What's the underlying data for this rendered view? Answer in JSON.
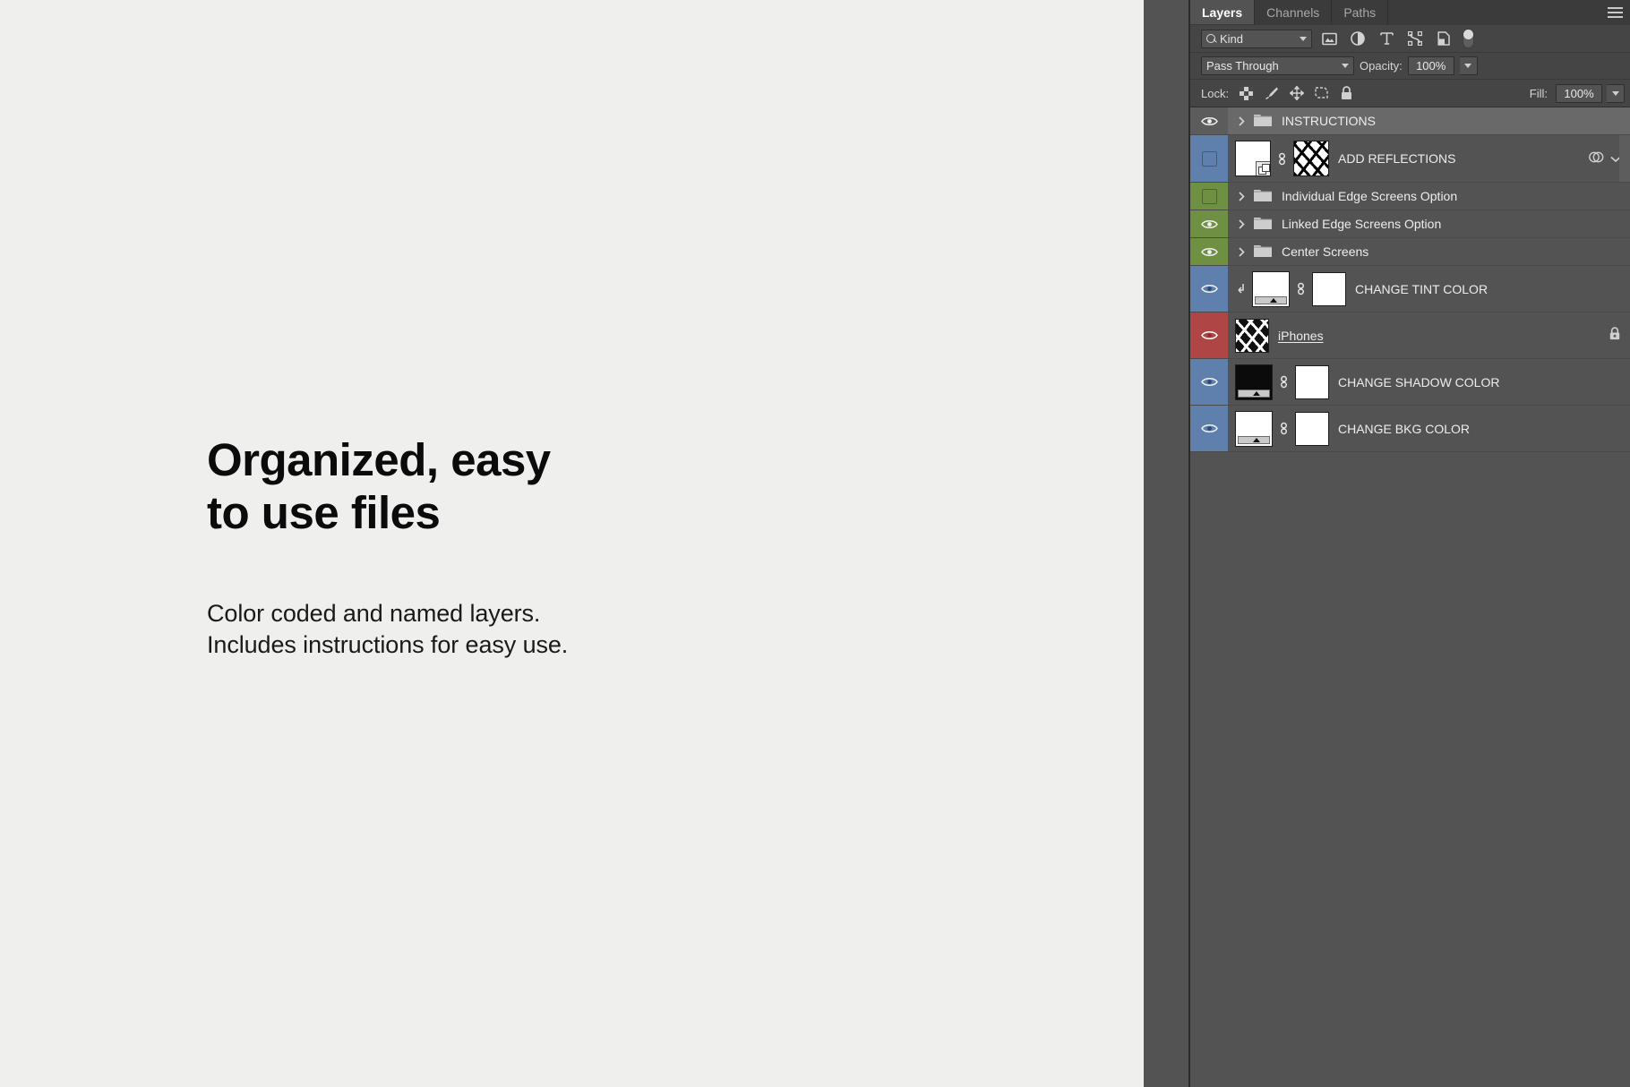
{
  "marketing": {
    "headline": "Organized, easy\nto use files",
    "subcopy": "Color coded and named layers.\nIncludes instructions for easy use."
  },
  "panel": {
    "tabs": [
      {
        "label": "Layers",
        "active": true
      },
      {
        "label": "Channels",
        "active": false
      },
      {
        "label": "Paths",
        "active": false
      }
    ],
    "menu_icon": "hamburger-menu-icon",
    "filter_row": {
      "kind_label": "Kind",
      "kind_icon": "search-icon",
      "filter_icons": [
        "pixel-layer-filter-icon",
        "adjustment-layer-filter-icon",
        "type-layer-filter-icon",
        "shape-layer-filter-icon",
        "smart-object-filter-icon"
      ],
      "toggle_name": "filter-enable-toggle"
    },
    "blend_row": {
      "blend_mode": "Pass Through",
      "opacity_label": "Opacity:",
      "opacity_value": "100%"
    },
    "lock_row": {
      "lock_label": "Lock:",
      "lock_icons": [
        "lock-transparent-pixels-icon",
        "lock-image-pixels-icon",
        "lock-position-icon",
        "lock-artboard-nesting-icon",
        "lock-all-icon"
      ],
      "fill_label": "Fill:",
      "fill_value": "100%"
    },
    "layers": [
      {
        "name": "INSTRUCTIONS",
        "type": "group",
        "color": "none",
        "visible": true,
        "selected": true,
        "locked": false,
        "renaming": false
      },
      {
        "name": "ADD REFLECTIONS",
        "type": "smart-object",
        "color": "blue",
        "visible": false,
        "selected": false,
        "locked": false,
        "renaming": false,
        "has_effects": true
      },
      {
        "name": "Individual Edge Screens Option",
        "type": "group",
        "color": "green",
        "visible": false,
        "selected": false,
        "locked": false,
        "renaming": false
      },
      {
        "name": "Linked Edge Screens Option",
        "type": "group",
        "color": "green",
        "visible": true,
        "selected": false,
        "locked": false,
        "renaming": false
      },
      {
        "name": "Center Screens",
        "type": "group",
        "color": "green",
        "visible": true,
        "selected": false,
        "locked": false,
        "renaming": false
      },
      {
        "name": "CHANGE TINT COLOR",
        "type": "adjustment",
        "color": "blue",
        "visible": true,
        "selected": false,
        "locked": false,
        "clipped": true,
        "renaming": false
      },
      {
        "name": "iPhones ",
        "type": "pixel",
        "color": "red",
        "visible": true,
        "selected": false,
        "locked": true,
        "renaming": true
      },
      {
        "name": "CHANGE SHADOW COLOR",
        "type": "adjustment",
        "color": "blue",
        "visible": true,
        "selected": false,
        "locked": false,
        "renaming": false
      },
      {
        "name": "CHANGE BKG COLOR",
        "type": "adjustment",
        "color": "blue",
        "visible": true,
        "selected": false,
        "locked": false,
        "renaming": false
      }
    ]
  },
  "colors": {
    "panel_bg": "#535353",
    "panel_header": "#454545",
    "label_blue": "#5f7fad",
    "label_green": "#6f8f42",
    "label_red": "#b04545",
    "selected_row": "#696969",
    "marketing_bg": "#efefee",
    "text_dark": "#0b0b0b"
  }
}
